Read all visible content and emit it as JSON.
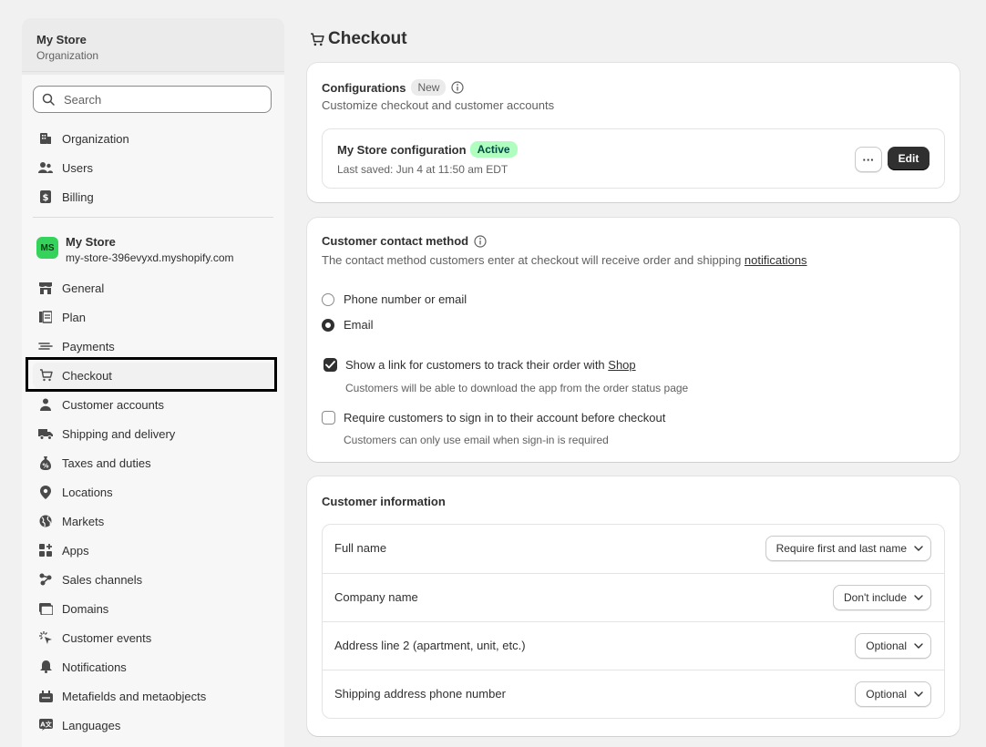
{
  "sidebar": {
    "org_name": "My Store",
    "org_sub": "Organization",
    "search_placeholder": "Search",
    "org_items": [
      {
        "label": "Organization",
        "icon": "building-icon"
      },
      {
        "label": "Users",
        "icon": "users-icon"
      },
      {
        "label": "Billing",
        "icon": "billing-icon"
      }
    ],
    "store": {
      "initials": "MS",
      "name": "My Store",
      "url": "my-store-396evyxd.myshopify.com"
    },
    "items": [
      {
        "label": "General",
        "icon": "store-icon"
      },
      {
        "label": "Plan",
        "icon": "plan-icon"
      },
      {
        "label": "Payments",
        "icon": "payments-icon"
      },
      {
        "label": "Checkout",
        "icon": "cart-icon",
        "active": true
      },
      {
        "label": "Customer accounts",
        "icon": "person-icon"
      },
      {
        "label": "Shipping and delivery",
        "icon": "truck-icon"
      },
      {
        "label": "Taxes and duties",
        "icon": "tax-icon"
      },
      {
        "label": "Locations",
        "icon": "location-icon"
      },
      {
        "label": "Markets",
        "icon": "globe-icon"
      },
      {
        "label": "Apps",
        "icon": "apps-icon"
      },
      {
        "label": "Sales channels",
        "icon": "channels-icon"
      },
      {
        "label": "Domains",
        "icon": "domains-icon"
      },
      {
        "label": "Customer events",
        "icon": "cursor-icon"
      },
      {
        "label": "Notifications",
        "icon": "bell-icon"
      },
      {
        "label": "Metafields and metaobjects",
        "icon": "metafields-icon"
      },
      {
        "label": "Languages",
        "icon": "language-icon"
      }
    ]
  },
  "page": {
    "title": "Checkout"
  },
  "configurations": {
    "title": "Configurations",
    "badge": "New",
    "subtitle": "Customize checkout and customer accounts",
    "config_name": "My Store configuration",
    "config_status": "Active",
    "last_saved": "Last saved: Jun 4 at 11:50 am EDT",
    "more_label": "···",
    "edit_label": "Edit"
  },
  "contact": {
    "title": "Customer contact method",
    "desc_prefix": "The contact method customers enter at checkout will receive order and shipping ",
    "desc_link": "notifications",
    "options": [
      "Phone number or email",
      "Email"
    ],
    "selected": "Email",
    "shop_link_prefix": "Show a link for customers to track their order with ",
    "shop_link": "Shop",
    "shop_link_checked": true,
    "shop_link_help": "Customers will be able to download the app from the order status page",
    "signin_label": "Require customers to sign in to their account before checkout",
    "signin_checked": false,
    "signin_help": "Customers can only use email when sign-in is required"
  },
  "customer_info": {
    "title": "Customer information",
    "rows": [
      {
        "label": "Full name",
        "value": "Require first and last name"
      },
      {
        "label": "Company name",
        "value": "Don't include"
      },
      {
        "label": "Address line 2 (apartment, unit, etc.)",
        "value": "Optional"
      },
      {
        "label": "Shipping address phone number",
        "value": "Optional"
      }
    ]
  },
  "colors": {
    "active_badge": "#affebf",
    "avatar": "#36d35c",
    "highlight_border": "#000000"
  }
}
